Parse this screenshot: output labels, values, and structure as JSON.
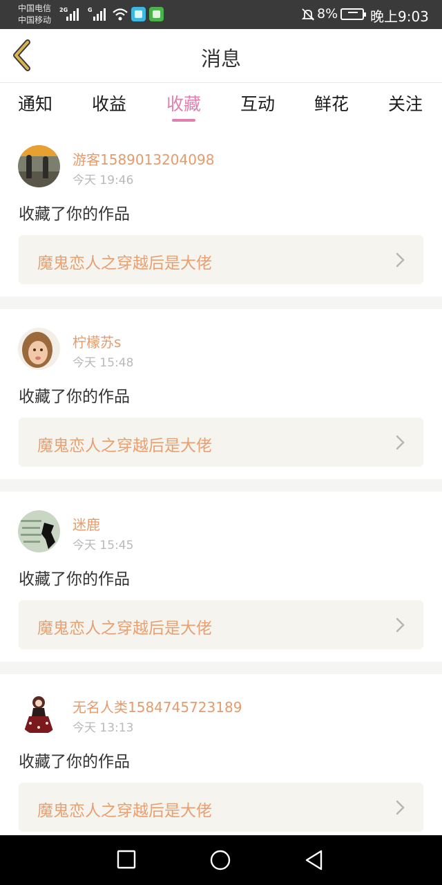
{
  "status_bar": {
    "carrier1": "中国电信",
    "carrier2": "中国移动",
    "net1": "2G",
    "net2": "G",
    "battery": "8%",
    "time": "晚上9:03",
    "icons": [
      "signal-icon",
      "wifi-icon",
      "app-book-icon",
      "app-reader-icon",
      "mute-bell-icon",
      "battery-icon"
    ]
  },
  "header": {
    "title": "消息",
    "back_icon": "chevron-left-icon"
  },
  "tabs": [
    {
      "label": "通知"
    },
    {
      "label": "收益"
    },
    {
      "label": "收藏",
      "active": true
    },
    {
      "label": "互动"
    },
    {
      "label": "鲜花"
    },
    {
      "label": "关注"
    }
  ],
  "notifications": [
    {
      "user": "游客1589013204098",
      "time": "今天 19:46",
      "action": "收藏了你的作品",
      "work": "魔鬼恋人之穿越后是大佬"
    },
    {
      "user": "柠檬苏s",
      "time": "今天 15:48",
      "action": "收藏了你的作品",
      "work": "魔鬼恋人之穿越后是大佬"
    },
    {
      "user": "迷鹿",
      "time": "今天 15:45",
      "action": "收藏了你的作品",
      "work": "魔鬼恋人之穿越后是大佬"
    },
    {
      "user": "无名人类1584745723189",
      "time": "今天 13:13",
      "action": "收藏了你的作品",
      "work": "魔鬼恋人之穿越后是大佬"
    }
  ],
  "colors": {
    "accent": "#e37fae",
    "username": "#e79a6a",
    "work_title": "#e9a070",
    "back_icon": "#d9b451"
  }
}
